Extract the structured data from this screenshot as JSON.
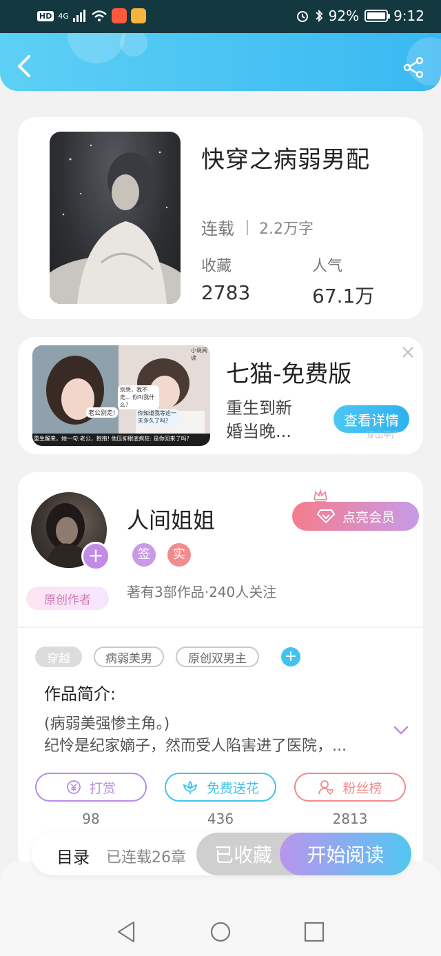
{
  "status_bar": {
    "network": "4G",
    "battery": "92%",
    "time": "9:12"
  },
  "book": {
    "title": "快穿之病弱男配",
    "status": "连载",
    "word_count": "2.2万字",
    "favorites_label": "收藏",
    "favorites_value": "2783",
    "popularity_label": "人气",
    "popularity_value": "67.1万"
  },
  "ad": {
    "title": "七猫-免费版",
    "desc_line1": "重生到新",
    "desc_line2": "婚当晚...",
    "button": "查看详情",
    "tiny_text": "穿山甲广",
    "image_caption": "小说阅读",
    "bubble1": "老公别走!",
    "bubble2": "别哭，我不走... 你叫我什么?",
    "bubble3": "你知道我等这一天多久了吗?",
    "ticker": "重生醒来，她一句:老公，抱抱! 他压抑眼底疯狂: 是你回来了吗?"
  },
  "author": {
    "name": "人间姐姐",
    "badge_sign": "签",
    "badge_real": "实",
    "stats": "著有3部作品·240人关注",
    "original_badge": "原创作者",
    "vip_button": "点亮会员"
  },
  "tags": [
    "穿越",
    "病弱美男",
    "原创双男主"
  ],
  "intro": {
    "title": "作品简介:",
    "line1": "(病弱美强惨主角。)",
    "line2": "纪怜是纪家嫡子，然而受人陷害进了医院，..."
  },
  "actions": [
    {
      "label": "打赏",
      "count": "98"
    },
    {
      "label": "免费送花",
      "count": "436"
    },
    {
      "label": "粉丝榜",
      "count": "2813"
    }
  ],
  "bottom": {
    "toc": "目录",
    "chapters": "已连载26章",
    "favorited": "已收藏",
    "read": "开始阅读"
  },
  "colors": {
    "header_start": "#5dd0f4",
    "header_end": "#39b8f2",
    "tip_purple": "#b98be6",
    "flower_cyan": "#3fc3ef",
    "fans_red": "#f08a8a"
  }
}
